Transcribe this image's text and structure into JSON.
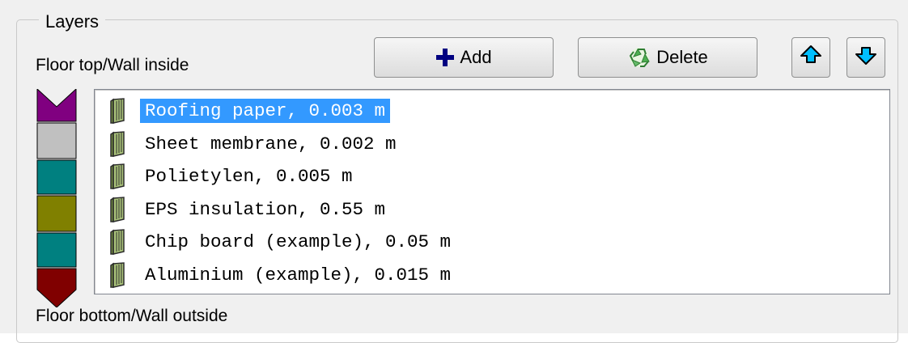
{
  "group": {
    "title": "Layers"
  },
  "labels": {
    "top": "Floor top/Wall inside",
    "bottom": "Floor bottom/Wall outside"
  },
  "toolbar": {
    "add_label": "Add",
    "add_icon": "plus-icon",
    "delete_label": "Delete",
    "delete_icon": "recycle-icon",
    "move_up_icon": "arrow-up-icon",
    "move_down_icon": "arrow-down-icon"
  },
  "layers": {
    "selected_index": 0,
    "items": [
      {
        "label": "Roofing paper, 0.003 m",
        "color": "#800080"
      },
      {
        "label": "Sheet membrane, 0.002 m",
        "color": "#c0c0c0"
      },
      {
        "label": "Polietylen, 0.005 m",
        "color": "#008080"
      },
      {
        "label": "EPS insulation, 0.55 m",
        "color": "#808000"
      },
      {
        "label": "Chip board (example), 0.05 m",
        "color": "#008080"
      },
      {
        "label": "Aluminium (example), 0.015 m",
        "color": "#800000"
      }
    ]
  },
  "colors": {
    "selection": "#3399ff",
    "up_down_arrow": "#00bfff",
    "plus": "#000080"
  }
}
